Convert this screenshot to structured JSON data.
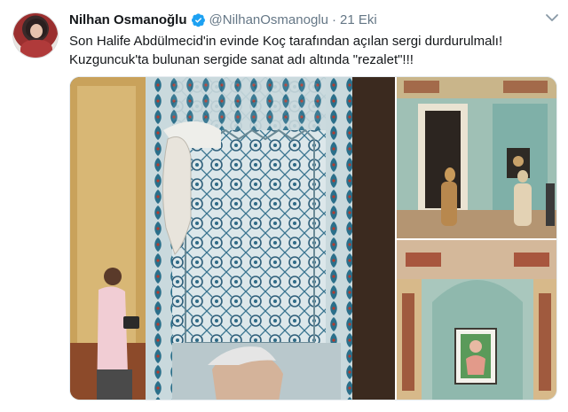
{
  "tweet": {
    "author_name": "Nilhan Osmanoğlu",
    "handle": "@NilhanOsmanoglu",
    "separator": "·",
    "date": "21 Eki",
    "text_line1": "Son Halife Abdülmecid'in evinde Koç tarafından açılan sergi durdurulmalı!",
    "text_line2": "Kuzguncuk'ta bulunan sergide sanat adı altında \"rezalet\"!!!",
    "verified": true
  },
  "colors": {
    "verified_badge": "#1da1f2",
    "secondary_text": "#657786",
    "primary_text": "#14171a"
  },
  "icons": {
    "verified": "verified-badge-icon",
    "menu": "chevron-down-icon"
  },
  "media": {
    "count": 3
  }
}
